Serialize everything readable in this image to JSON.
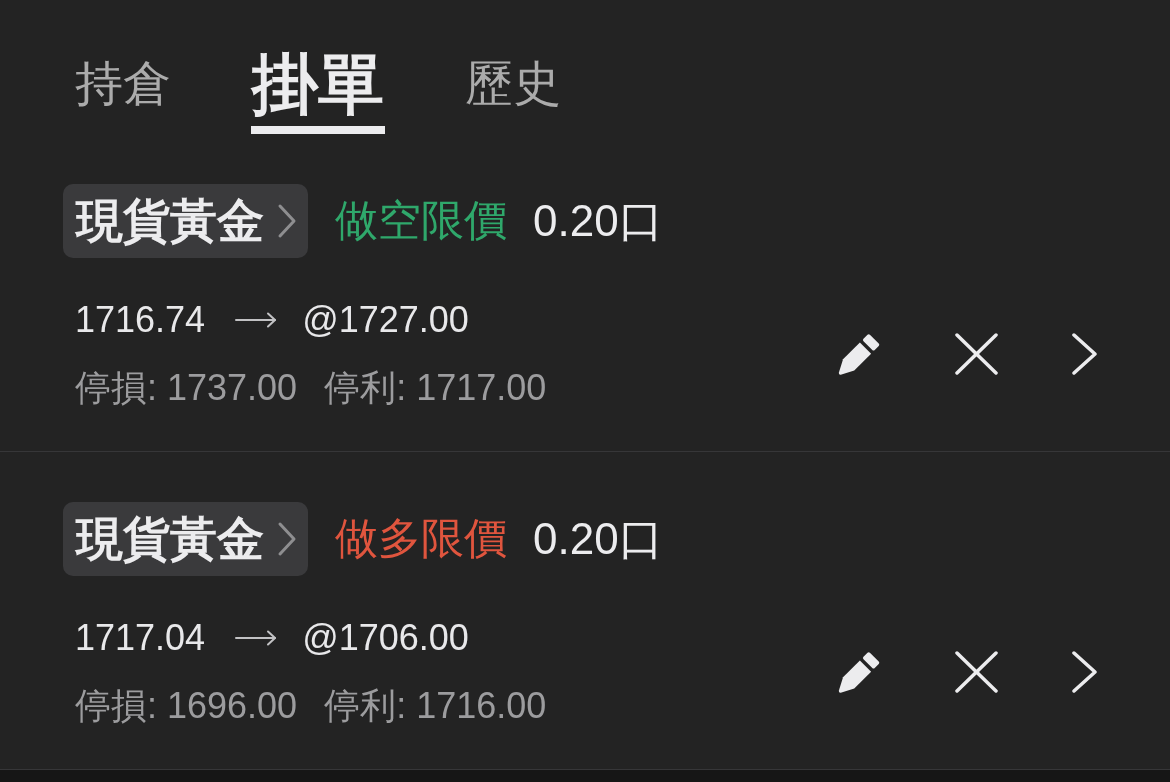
{
  "tabs": [
    {
      "label": "持倉",
      "selected": false
    },
    {
      "label": "掛單",
      "selected": true
    },
    {
      "label": "歷史",
      "selected": false
    }
  ],
  "orders": [
    {
      "symbol": "現貨黃金",
      "order_type": {
        "label": "做空限價",
        "color": "#2fa86b"
      },
      "lots": "0.20口",
      "current_price": "1716.74",
      "limit_price": "@1727.00",
      "stop_loss": "停損: 1737.00",
      "take_profit": "停利: 1717.00"
    },
    {
      "symbol": "現貨黃金",
      "order_type": {
        "label": "做多限價",
        "color": "#e0553e"
      },
      "lots": "0.20口",
      "current_price": "1717.04",
      "limit_price": "@1706.00",
      "stop_loss": "停損: 1696.00",
      "take_profit": "停利: 1716.00"
    }
  ]
}
